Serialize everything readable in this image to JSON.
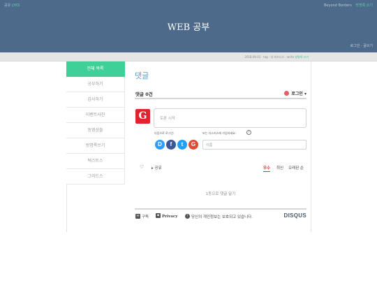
{
  "header": {
    "top_left_prefix": "공유",
    "top_left_label": "LYKS",
    "top_right_text": "Beyond Borders",
    "top_right_link": "방명록 쓰기",
    "site_title": "WEB 공부",
    "menu_text": "로그인 · 글쓰기"
  },
  "subbar": {
    "text": "2018.09.03 · tag · 내 비즈니스 · write",
    "accent": "방명록 쓰기"
  },
  "sidebar": {
    "items": [
      {
        "label": "전체 목록"
      },
      {
        "label": "공부하기"
      },
      {
        "label": "감사하기"
      },
      {
        "label": "이벤트사진"
      },
      {
        "label": "동영상들"
      },
      {
        "label": "방명록쓰기"
      },
      {
        "label": "텍스트스"
      },
      {
        "label": "그리드스"
      }
    ]
  },
  "comments": {
    "heading": "댓글",
    "count": "댓글 0건",
    "login": "로그인 ▾",
    "textarea_placeholder": "토론 시작",
    "social_login_label": "다음으로 로그인:",
    "disqus_signup_label": "또는 디스커스에 가입하세요:",
    "help": "?",
    "social": [
      "D",
      "f",
      "t",
      "G"
    ],
    "name_placeholder": "이름",
    "share": "공유",
    "sort": {
      "best": "우수",
      "newest": "최신",
      "oldest": "오래된 순"
    },
    "first_comment": "1등으로 댓글 달기"
  },
  "footer": {
    "subscribe": "구독",
    "privacy": "Privacy",
    "notice": "당신의 개인정보는 보호되고 있습니다.",
    "brand": "DISQUS"
  },
  "colors": {
    "header_bg": "#4d6a8b",
    "sidebar_active": "#3fd097",
    "accent_link": "#4d9fc7",
    "disqus_red": "#e53935"
  }
}
